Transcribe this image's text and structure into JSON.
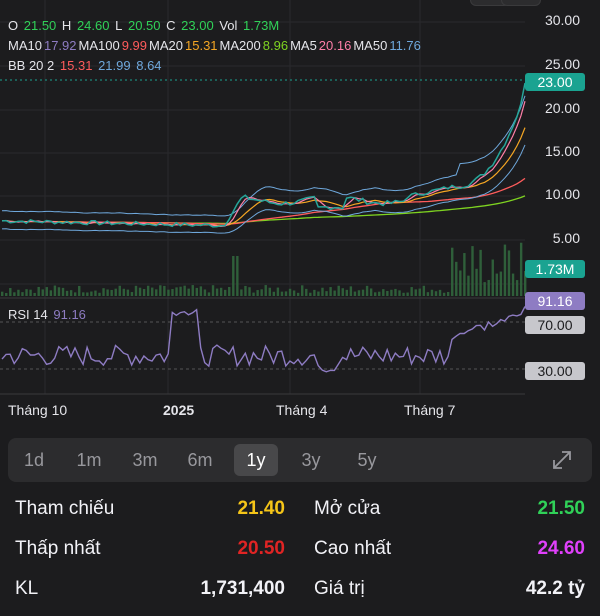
{
  "ohlc": {
    "o_label": "O",
    "o": "21.50",
    "h_label": "H",
    "h": "24.60",
    "l_label": "L",
    "l": "20.50",
    "c_label": "C",
    "c": "23.00",
    "vol_label": "Vol",
    "vol": "1.73M"
  },
  "ma": [
    {
      "label": "MA10",
      "value": "17.92",
      "color": "#8e7cc3"
    },
    {
      "label": "MA100",
      "value": "9.99",
      "color": "#ff5c5c"
    },
    {
      "label": "MA20",
      "value": "15.31",
      "color": "#f5a623"
    },
    {
      "label": "MA200",
      "value": "8.96",
      "color": "#7ed321"
    },
    {
      "label": "MA5",
      "value": "20.16",
      "color": "#ff7fa8"
    },
    {
      "label": "MA50",
      "value": "11.76",
      "color": "#6fa8dc"
    }
  ],
  "bb": {
    "label": "BB 20 2",
    "lower": "15.31",
    "mid": "21.99",
    "upper": "8.64",
    "lower_color": "#ff5c5c",
    "mid_color": "#6fa8dc",
    "upper_color": "#6fa8dc"
  },
  "price_axis": [
    "30.00",
    "25.00",
    "20.00",
    "15.00",
    "10.00",
    "5.00"
  ],
  "current_price": "23.00",
  "volume_tag": "1.73M",
  "rsi": {
    "label": "RSI 14",
    "value": "91.16",
    "level_high": "70.00",
    "level_low": "30.00"
  },
  "x_labels": [
    "Tháng 10",
    "2025",
    "Tháng 4",
    "Tháng 7"
  ],
  "timeframes": [
    "1d",
    "1m",
    "3m",
    "6m",
    "1y",
    "3y",
    "5y"
  ],
  "active_timeframe": "1y",
  "expand_icon": "expand-arrows-icon",
  "stats": {
    "reference_label": "Tham chiếu",
    "reference_value": "21.40",
    "open_label": "Mở cửa",
    "open_value": "21.50",
    "low_label": "Thấp nhất",
    "low_value": "20.50",
    "high_label": "Cao nhất",
    "high_value": "24.60",
    "volume_label": "KL",
    "volume_value": "1,731,400",
    "turnover_label": "Giá trị",
    "turnover_value": "42.2 tỷ"
  },
  "colors": {
    "reference": "#f5c518",
    "open": "#30d158",
    "low": "#e02424",
    "high": "#e040fb",
    "price_tag": "#1aa391",
    "rsi_tag": "#8e7cc3",
    "rsi_line": "#8e7cc3",
    "level_tag": "#c7c7cc"
  }
}
